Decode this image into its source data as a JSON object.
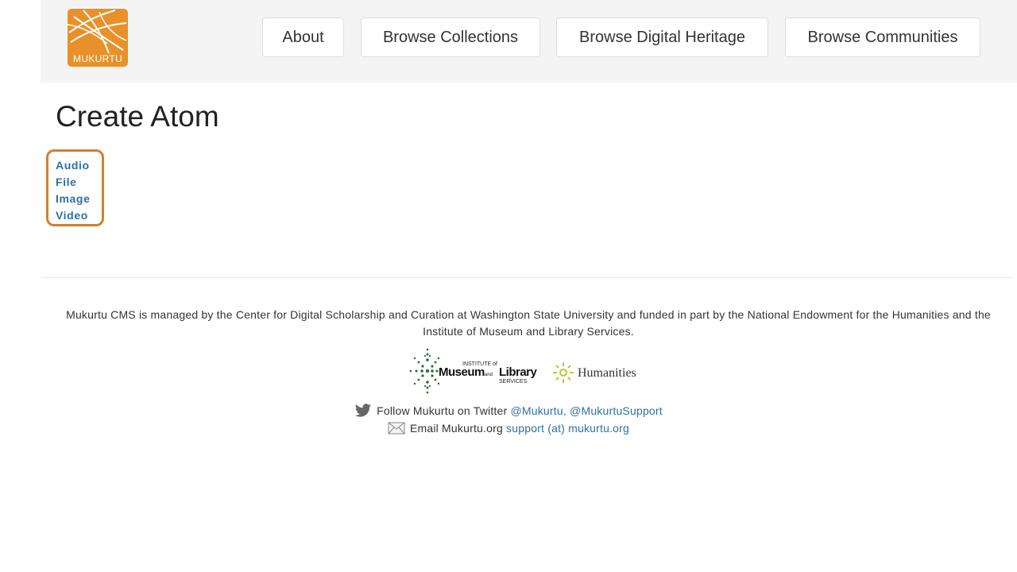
{
  "header": {
    "logo_text": "MUKURTU",
    "nav": [
      {
        "label": "About"
      },
      {
        "label": "Browse Collections"
      },
      {
        "label": "Browse Digital Heritage"
      },
      {
        "label": "Browse Communities"
      }
    ]
  },
  "main": {
    "title": "Create Atom",
    "atoms": [
      {
        "label": "Audio"
      },
      {
        "label": "File"
      },
      {
        "label": "Image"
      },
      {
        "label": "Video"
      }
    ]
  },
  "footer": {
    "description": "Mukurtu CMS is managed by the Center for Digital Scholarship and Curation at Washington State University and funded in part by the National Endowment for the Humanities and the Institute of Museum and Library Services.",
    "imls_logo": {
      "line1": "INSTITUTE of",
      "line2a": "Museum",
      "line2b": "and",
      "line2c": "Library",
      "line3": "SERVICES"
    },
    "neh_logo": {
      "text": "Humanities"
    },
    "twitter": {
      "prefix": "Follow Mukurtu on Twitter",
      "link1": "@Mukurtu,",
      "link2": "@MukurtuSupport"
    },
    "email": {
      "prefix": "Email Mukurtu.org",
      "link": "support (at) mukurtu.org"
    }
  },
  "colors": {
    "accent": "#e8912a",
    "link": "#2c6fa6",
    "highlight_box": "#d08031",
    "header_bg": "#f5f4f4"
  }
}
